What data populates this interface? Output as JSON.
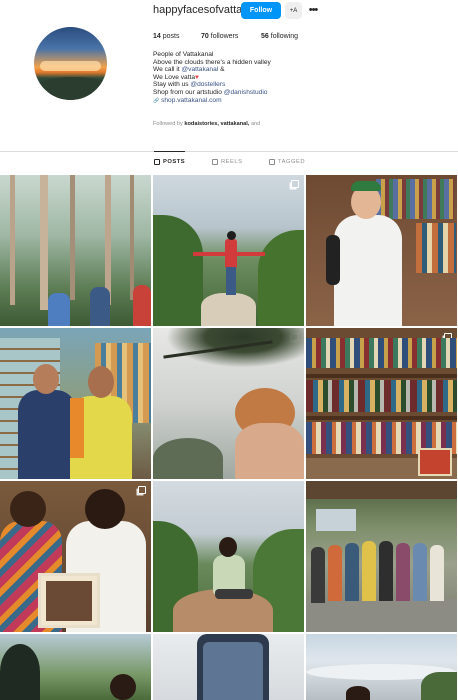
{
  "profile": {
    "username": "happyfacesofvatta",
    "follow_label": "Follow",
    "add_user_label": "+A",
    "more_label": "•••",
    "stats": {
      "posts_count": "14",
      "posts_label": "posts",
      "followers_count": "70",
      "followers_label": "followers",
      "following_count": "56",
      "following_label": "following"
    },
    "bio": {
      "name": "People of Vattakanal",
      "line1": "Above the clouds there's a hidden valley",
      "line2_prefix": "We call it ",
      "line2_link": "@vattakanal",
      "line2_suffix": " &",
      "line3_prefix": "We Love vatta",
      "line3_heart": "♥",
      "line4_prefix": "Stay with us ",
      "line4_link": "@dostellers",
      "line5_prefix": "Shop from our artstudio ",
      "line5_link": "@danishstudio",
      "website_icon": "🔗",
      "website": "shop.vattakanal.com"
    },
    "followed_by": {
      "prefix": "Followed by ",
      "names": "kodaistories, vattakanal,",
      "suffix": " and"
    }
  },
  "tabs": [
    {
      "label": "POSTS",
      "icon": "grid-icon"
    },
    {
      "label": "REELS",
      "icon": "reels-icon"
    },
    {
      "label": "TAGGED",
      "icon": "tagged-icon"
    }
  ],
  "posts": [
    {
      "subject": "forest-walk",
      "multi": false
    },
    {
      "subject": "rock-outstretched-arms",
      "multi": true
    },
    {
      "subject": "bookshop-man",
      "multi": true
    },
    {
      "subject": "shop-two-men",
      "multi": false
    },
    {
      "subject": "hair-cliff",
      "multi": true
    },
    {
      "subject": "bookshelf",
      "multi": true
    },
    {
      "subject": "women-photo",
      "multi": true
    },
    {
      "subject": "woman-rock",
      "multi": false
    },
    {
      "subject": "group-photo",
      "multi": true
    },
    {
      "subject": "person-mountains",
      "multi": false
    },
    {
      "subject": "phone-sky",
      "multi": false
    },
    {
      "subject": "cloud-sky",
      "multi": false
    }
  ],
  "colors": {
    "accent": "#0095f6",
    "link": "#385185",
    "muted": "#8e8e8e",
    "text": "#262626"
  }
}
